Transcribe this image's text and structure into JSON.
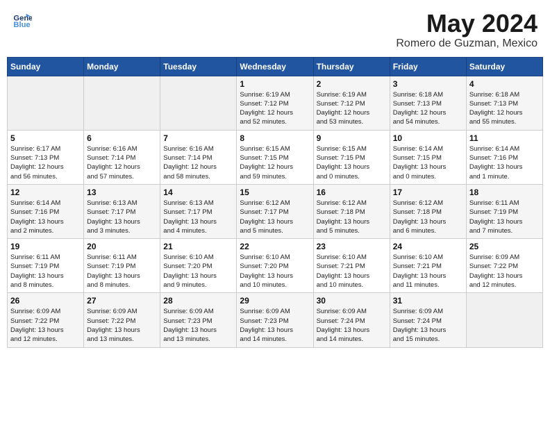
{
  "header": {
    "logo_line1": "General",
    "logo_line2": "Blue",
    "month_year": "May 2024",
    "location": "Romero de Guzman, Mexico"
  },
  "days_of_week": [
    "Sunday",
    "Monday",
    "Tuesday",
    "Wednesday",
    "Thursday",
    "Friday",
    "Saturday"
  ],
  "weeks": [
    [
      {
        "day": "",
        "info": ""
      },
      {
        "day": "",
        "info": ""
      },
      {
        "day": "",
        "info": ""
      },
      {
        "day": "1",
        "info": "Sunrise: 6:19 AM\nSunset: 7:12 PM\nDaylight: 12 hours\nand 52 minutes."
      },
      {
        "day": "2",
        "info": "Sunrise: 6:19 AM\nSunset: 7:12 PM\nDaylight: 12 hours\nand 53 minutes."
      },
      {
        "day": "3",
        "info": "Sunrise: 6:18 AM\nSunset: 7:13 PM\nDaylight: 12 hours\nand 54 minutes."
      },
      {
        "day": "4",
        "info": "Sunrise: 6:18 AM\nSunset: 7:13 PM\nDaylight: 12 hours\nand 55 minutes."
      }
    ],
    [
      {
        "day": "5",
        "info": "Sunrise: 6:17 AM\nSunset: 7:13 PM\nDaylight: 12 hours\nand 56 minutes."
      },
      {
        "day": "6",
        "info": "Sunrise: 6:16 AM\nSunset: 7:14 PM\nDaylight: 12 hours\nand 57 minutes."
      },
      {
        "day": "7",
        "info": "Sunrise: 6:16 AM\nSunset: 7:14 PM\nDaylight: 12 hours\nand 58 minutes."
      },
      {
        "day": "8",
        "info": "Sunrise: 6:15 AM\nSunset: 7:15 PM\nDaylight: 12 hours\nand 59 minutes."
      },
      {
        "day": "9",
        "info": "Sunrise: 6:15 AM\nSunset: 7:15 PM\nDaylight: 13 hours\nand 0 minutes."
      },
      {
        "day": "10",
        "info": "Sunrise: 6:14 AM\nSunset: 7:15 PM\nDaylight: 13 hours\nand 0 minutes."
      },
      {
        "day": "11",
        "info": "Sunrise: 6:14 AM\nSunset: 7:16 PM\nDaylight: 13 hours\nand 1 minute."
      }
    ],
    [
      {
        "day": "12",
        "info": "Sunrise: 6:14 AM\nSunset: 7:16 PM\nDaylight: 13 hours\nand 2 minutes."
      },
      {
        "day": "13",
        "info": "Sunrise: 6:13 AM\nSunset: 7:17 PM\nDaylight: 13 hours\nand 3 minutes."
      },
      {
        "day": "14",
        "info": "Sunrise: 6:13 AM\nSunset: 7:17 PM\nDaylight: 13 hours\nand 4 minutes."
      },
      {
        "day": "15",
        "info": "Sunrise: 6:12 AM\nSunset: 7:17 PM\nDaylight: 13 hours\nand 5 minutes."
      },
      {
        "day": "16",
        "info": "Sunrise: 6:12 AM\nSunset: 7:18 PM\nDaylight: 13 hours\nand 5 minutes."
      },
      {
        "day": "17",
        "info": "Sunrise: 6:12 AM\nSunset: 7:18 PM\nDaylight: 13 hours\nand 6 minutes."
      },
      {
        "day": "18",
        "info": "Sunrise: 6:11 AM\nSunset: 7:19 PM\nDaylight: 13 hours\nand 7 minutes."
      }
    ],
    [
      {
        "day": "19",
        "info": "Sunrise: 6:11 AM\nSunset: 7:19 PM\nDaylight: 13 hours\nand 8 minutes."
      },
      {
        "day": "20",
        "info": "Sunrise: 6:11 AM\nSunset: 7:19 PM\nDaylight: 13 hours\nand 8 minutes."
      },
      {
        "day": "21",
        "info": "Sunrise: 6:10 AM\nSunset: 7:20 PM\nDaylight: 13 hours\nand 9 minutes."
      },
      {
        "day": "22",
        "info": "Sunrise: 6:10 AM\nSunset: 7:20 PM\nDaylight: 13 hours\nand 10 minutes."
      },
      {
        "day": "23",
        "info": "Sunrise: 6:10 AM\nSunset: 7:21 PM\nDaylight: 13 hours\nand 10 minutes."
      },
      {
        "day": "24",
        "info": "Sunrise: 6:10 AM\nSunset: 7:21 PM\nDaylight: 13 hours\nand 11 minutes."
      },
      {
        "day": "25",
        "info": "Sunrise: 6:09 AM\nSunset: 7:22 PM\nDaylight: 13 hours\nand 12 minutes."
      }
    ],
    [
      {
        "day": "26",
        "info": "Sunrise: 6:09 AM\nSunset: 7:22 PM\nDaylight: 13 hours\nand 12 minutes."
      },
      {
        "day": "27",
        "info": "Sunrise: 6:09 AM\nSunset: 7:22 PM\nDaylight: 13 hours\nand 13 minutes."
      },
      {
        "day": "28",
        "info": "Sunrise: 6:09 AM\nSunset: 7:23 PM\nDaylight: 13 hours\nand 13 minutes."
      },
      {
        "day": "29",
        "info": "Sunrise: 6:09 AM\nSunset: 7:23 PM\nDaylight: 13 hours\nand 14 minutes."
      },
      {
        "day": "30",
        "info": "Sunrise: 6:09 AM\nSunset: 7:24 PM\nDaylight: 13 hours\nand 14 minutes."
      },
      {
        "day": "31",
        "info": "Sunrise: 6:09 AM\nSunset: 7:24 PM\nDaylight: 13 hours\nand 15 minutes."
      },
      {
        "day": "",
        "info": ""
      }
    ]
  ]
}
